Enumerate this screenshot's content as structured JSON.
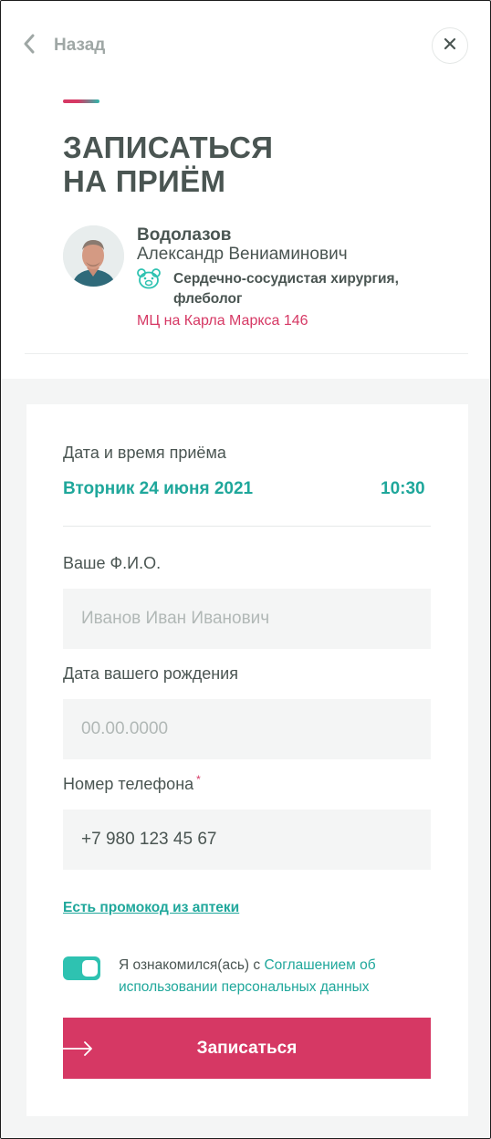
{
  "header": {
    "back_label": "Назад",
    "title_line1": "ЗАПИСАТЬСЯ",
    "title_line2": "НА ПРИЁМ"
  },
  "doctor": {
    "surname": "Водолазов",
    "name": "Александр Вениаминович",
    "specialty": "Сердечно-сосудистая хирургия, флеболог",
    "clinic": "МЦ на Карла Маркса 146"
  },
  "appointment": {
    "label": "Дата и время приёма",
    "date": "Вторник 24 июня 2021",
    "time": "10:30"
  },
  "form": {
    "fio_label": "Ваше Ф.И.О.",
    "fio_placeholder": "Иванов Иван Иванович",
    "birth_label": "Дата вашего рождения",
    "birth_placeholder": "00.00.0000",
    "phone_label": "Номер телефона",
    "phone_required_mark": "*",
    "phone_value": "+7 980 123 45 67",
    "promo_link": "Есть промокод из аптеки",
    "consent_toggle_on": true,
    "consent_text": "Я ознакомился(ась) с ",
    "consent_link": "Соглашением об использовании персональных данных",
    "submit_label": "Записаться"
  },
  "icons": {
    "back": "chevron-left-icon",
    "close": "close-icon",
    "specialty": "teddy-bear-icon",
    "submit": "arrow-right-icon"
  },
  "colors": {
    "accent_pink": "#d63864",
    "accent_teal": "#1fa79b",
    "toggle_teal": "#2ec2b1",
    "text": "#4a5552",
    "muted": "#9fa7a5"
  }
}
